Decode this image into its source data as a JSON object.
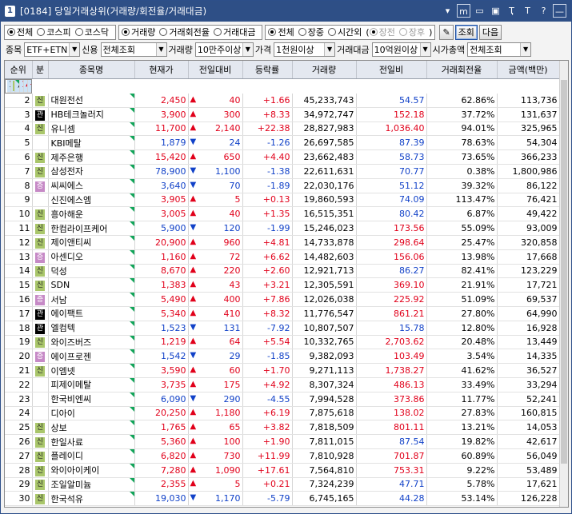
{
  "titlebar": {
    "num": "1",
    "title": "[0184] 당일거래상위(거래량/회전율/거래대금)",
    "icons": [
      "down-triangle-icon",
      "m-box-icon",
      "restore-icon",
      "window-icon",
      "pin-icon",
      "font-icon",
      "help-icon",
      "close-icon"
    ],
    "glyphs": [
      "▾",
      "m",
      "▭",
      "▣",
      "Ҭ",
      "T",
      "?",
      "—"
    ]
  },
  "filter1": {
    "market": [
      "전체",
      "코스피",
      "코스닥"
    ],
    "sort": [
      "거래량",
      "거래회전율",
      "거래대금"
    ],
    "session": [
      "전체",
      "장중",
      "시간외"
    ],
    "session_sub": [
      "장전",
      "장후"
    ],
    "pen_icon": "✎",
    "search": "조회",
    "next": "다음"
  },
  "filter2": {
    "stock_label": "종목",
    "stock_val": "ETF+ETN 제",
    "credit_label": "신용",
    "credit_val": "전체조회",
    "volume_label": "거래량",
    "volume_val": "10만주이상",
    "price_label": "가격",
    "price_val": "1천원이상",
    "amount_label": "거래대금",
    "amount_val": "10억원이상",
    "cap_label": "시가총액",
    "cap_val": "전체조회"
  },
  "columns": [
    "순위",
    "분",
    "종목명",
    "현재가",
    "전일대비",
    "등락률",
    "거래량",
    "전일비",
    "거래회전율",
    "금액(백만)"
  ],
  "colors": {
    "up": "#e1001a",
    "down": "#1141c8",
    "accent": "#2e4f86"
  },
  "rows": [
    {
      "rank": "1",
      "badge": "신",
      "name": "씨엔알리서치",
      "price": "1,758",
      "dir": "up",
      "chg": "304",
      "rate": "+20.91",
      "vol": "52,229,089",
      "prev": "5,640.28",
      "turn": "95.10%",
      "amt": "91,147"
    },
    {
      "rank": "2",
      "badge": "신",
      "name": "대원전선",
      "price": "2,450",
      "dir": "up",
      "chg": "40",
      "rate": "+1.66",
      "vol": "45,233,743",
      "prev": "54.57",
      "turn": "62.86%",
      "amt": "113,736"
    },
    {
      "rank": "3",
      "badge": "관",
      "name": "HB테크놀러지",
      "price": "3,900",
      "dir": "up",
      "chg": "300",
      "rate": "+8.33",
      "vol": "34,972,747",
      "prev": "152.18",
      "turn": "37.72%",
      "amt": "131,637"
    },
    {
      "rank": "4",
      "badge": "신",
      "name": "유니셈",
      "price": "11,700",
      "dir": "up",
      "chg": "2,140",
      "rate": "+22.38",
      "vol": "28,827,983",
      "prev": "1,036.40",
      "turn": "94.01%",
      "amt": "325,965"
    },
    {
      "rank": "5",
      "badge": "",
      "name": "KBI메탈",
      "price": "1,879",
      "dir": "down",
      "chg": "24",
      "rate": "-1.26",
      "vol": "26,697,585",
      "prev": "87.39",
      "turn": "78.63%",
      "amt": "54,304"
    },
    {
      "rank": "6",
      "badge": "신",
      "name": "제주은행",
      "price": "15,420",
      "dir": "up",
      "chg": "650",
      "rate": "+4.40",
      "vol": "23,662,483",
      "prev": "58.73",
      "turn": "73.65%",
      "amt": "366,233"
    },
    {
      "rank": "7",
      "badge": "신",
      "name": "삼성전자",
      "price": "78,900",
      "dir": "down",
      "chg": "1,100",
      "rate": "-1.38",
      "vol": "22,611,631",
      "prev": "70.77",
      "turn": "0.38%",
      "amt": "1,800,986"
    },
    {
      "rank": "8",
      "badge": "증",
      "name": "씨씨에스",
      "price": "3,640",
      "dir": "down",
      "chg": "70",
      "rate": "-1.89",
      "vol": "22,030,176",
      "prev": "51.12",
      "turn": "39.32%",
      "amt": "86,122"
    },
    {
      "rank": "9",
      "badge": "",
      "name": "신진에스엠",
      "price": "3,905",
      "dir": "up",
      "chg": "5",
      "rate": "+0.13",
      "vol": "19,860,593",
      "prev": "74.09",
      "turn": "113.47%",
      "amt": "76,421"
    },
    {
      "rank": "10",
      "badge": "신",
      "name": "흥아해운",
      "price": "3,005",
      "dir": "up",
      "chg": "40",
      "rate": "+1.35",
      "vol": "16,515,351",
      "prev": "80.42",
      "turn": "6.87%",
      "amt": "49,422"
    },
    {
      "rank": "11",
      "badge": "신",
      "name": "한컴라이프케어",
      "price": "5,900",
      "dir": "down",
      "chg": "120",
      "rate": "-1.99",
      "vol": "15,246,023",
      "prev": "173.56",
      "turn": "55.09%",
      "amt": "93,009"
    },
    {
      "rank": "12",
      "badge": "신",
      "name": "제이앤티씨",
      "price": "20,900",
      "dir": "up",
      "chg": "960",
      "rate": "+4.81",
      "vol": "14,733,878",
      "prev": "298.64",
      "turn": "25.47%",
      "amt": "320,858"
    },
    {
      "rank": "13",
      "badge": "증",
      "name": "아센디오",
      "price": "1,160",
      "dir": "up",
      "chg": "72",
      "rate": "+6.62",
      "vol": "14,482,603",
      "prev": "156.06",
      "turn": "13.98%",
      "amt": "17,668"
    },
    {
      "rank": "14",
      "badge": "신",
      "name": "덕성",
      "price": "8,670",
      "dir": "up",
      "chg": "220",
      "rate": "+2.60",
      "vol": "12,921,713",
      "prev": "86.27",
      "turn": "82.41%",
      "amt": "123,229"
    },
    {
      "rank": "15",
      "badge": "신",
      "name": "SDN",
      "price": "1,383",
      "dir": "up",
      "chg": "43",
      "rate": "+3.21",
      "vol": "12,305,591",
      "prev": "369.10",
      "turn": "21.91%",
      "amt": "17,721"
    },
    {
      "rank": "16",
      "badge": "증",
      "name": "서남",
      "price": "5,490",
      "dir": "up",
      "chg": "400",
      "rate": "+7.86",
      "vol": "12,026,038",
      "prev": "225.92",
      "turn": "51.09%",
      "amt": "69,537"
    },
    {
      "rank": "17",
      "badge": "관",
      "name": "에이팩트",
      "price": "5,340",
      "dir": "up",
      "chg": "410",
      "rate": "+8.32",
      "vol": "11,776,547",
      "prev": "861.21",
      "turn": "27.80%",
      "amt": "64,990"
    },
    {
      "rank": "18",
      "badge": "관",
      "name": "엘컴텍",
      "price": "1,523",
      "dir": "down",
      "chg": "131",
      "rate": "-7.92",
      "vol": "10,807,507",
      "prev": "15.78",
      "turn": "12.80%",
      "amt": "16,928"
    },
    {
      "rank": "19",
      "badge": "신",
      "name": "와이즈버즈",
      "price": "1,219",
      "dir": "up",
      "chg": "64",
      "rate": "+5.54",
      "vol": "10,332,765",
      "prev": "2,703.62",
      "turn": "20.48%",
      "amt": "13,449"
    },
    {
      "rank": "20",
      "badge": "증",
      "name": "에이프로젠",
      "price": "1,542",
      "dir": "down",
      "chg": "29",
      "rate": "-1.85",
      "vol": "9,382,093",
      "prev": "103.49",
      "turn": "3.54%",
      "amt": "14,335"
    },
    {
      "rank": "21",
      "badge": "신",
      "name": "이엠넷",
      "price": "3,590",
      "dir": "up",
      "chg": "60",
      "rate": "+1.70",
      "vol": "9,271,113",
      "prev": "1,738.27",
      "turn": "41.62%",
      "amt": "36,527"
    },
    {
      "rank": "22",
      "badge": "",
      "name": "피제이메탈",
      "price": "3,735",
      "dir": "up",
      "chg": "175",
      "rate": "+4.92",
      "vol": "8,307,324",
      "prev": "486.13",
      "turn": "33.49%",
      "amt": "33,294"
    },
    {
      "rank": "23",
      "badge": "",
      "name": "한국비엔씨",
      "price": "6,090",
      "dir": "down",
      "chg": "290",
      "rate": "-4.55",
      "vol": "7,994,528",
      "prev": "373.86",
      "turn": "11.77%",
      "amt": "52,241"
    },
    {
      "rank": "24",
      "badge": "",
      "name": "디아이",
      "price": "20,250",
      "dir": "up",
      "chg": "1,180",
      "rate": "+6.19",
      "vol": "7,875,618",
      "prev": "138.02",
      "turn": "27.83%",
      "amt": "160,815"
    },
    {
      "rank": "25",
      "badge": "신",
      "name": "상보",
      "price": "1,765",
      "dir": "up",
      "chg": "65",
      "rate": "+3.82",
      "vol": "7,818,509",
      "prev": "801.11",
      "turn": "13.21%",
      "amt": "14,053"
    },
    {
      "rank": "26",
      "badge": "신",
      "name": "한일사료",
      "price": "5,360",
      "dir": "up",
      "chg": "100",
      "rate": "+1.90",
      "vol": "7,811,015",
      "prev": "87.54",
      "turn": "19.82%",
      "amt": "42,617"
    },
    {
      "rank": "27",
      "badge": "신",
      "name": "플레이디",
      "price": "6,820",
      "dir": "up",
      "chg": "730",
      "rate": "+11.99",
      "vol": "7,810,928",
      "prev": "701.87",
      "turn": "60.89%",
      "amt": "56,049"
    },
    {
      "rank": "28",
      "badge": "신",
      "name": "와이아이케이",
      "price": "7,280",
      "dir": "up",
      "chg": "1,090",
      "rate": "+17.61",
      "vol": "7,564,810",
      "prev": "753.31",
      "turn": "9.22%",
      "amt": "53,489"
    },
    {
      "rank": "29",
      "badge": "신",
      "name": "조일알미늄",
      "price": "2,355",
      "dir": "up",
      "chg": "5",
      "rate": "+0.21",
      "vol": "7,324,239",
      "prev": "47.71",
      "turn": "5.78%",
      "amt": "17,621"
    },
    {
      "rank": "30",
      "badge": "신",
      "name": "한국석유",
      "price": "19,030",
      "dir": "down",
      "chg": "1,170",
      "rate": "-5.79",
      "vol": "6,745,165",
      "prev": "44.28",
      "turn": "53.14%",
      "amt": "126,228"
    }
  ]
}
